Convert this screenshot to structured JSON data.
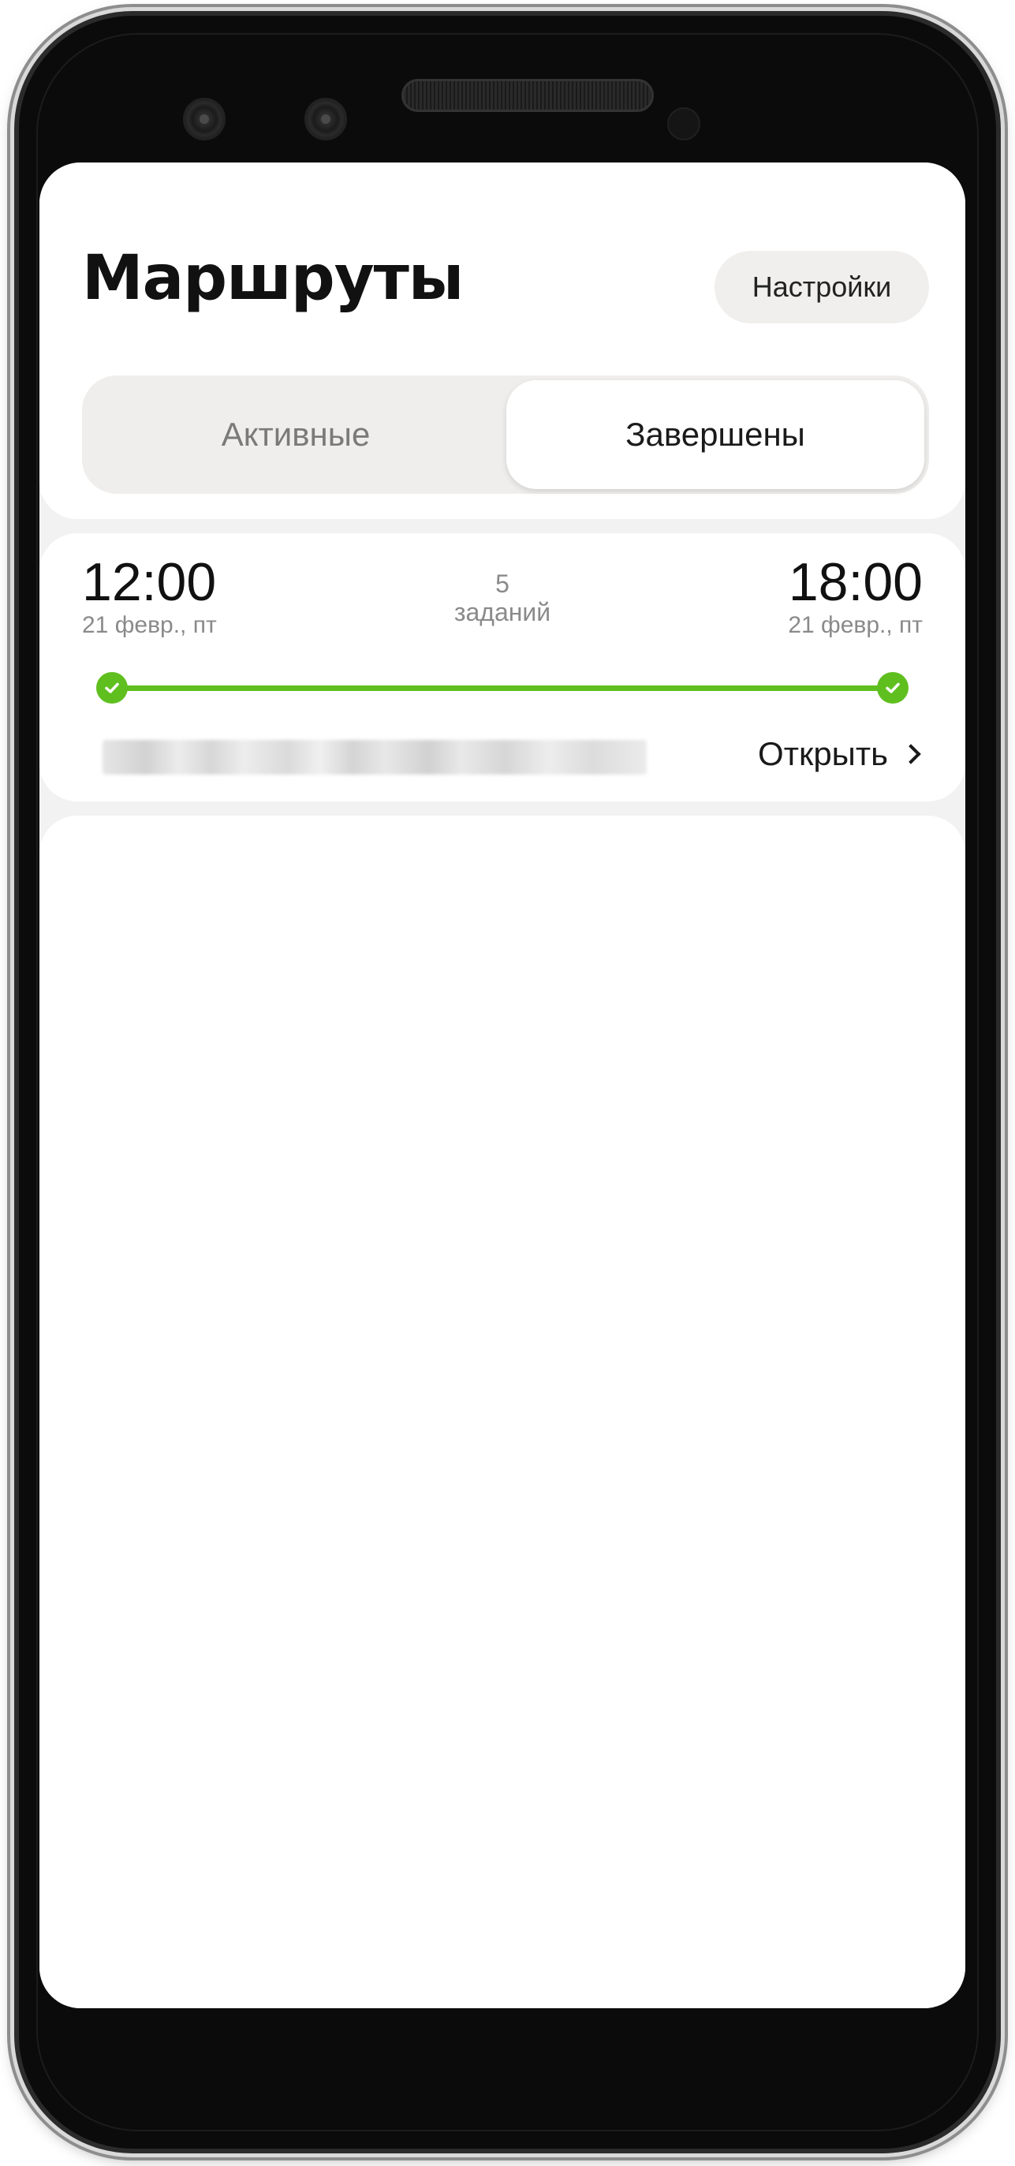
{
  "header": {
    "title": "Маршруты",
    "settings_label": "Настройки"
  },
  "tabs": [
    {
      "label": "Активные",
      "active": false
    },
    {
      "label": "Завершены",
      "active": true
    }
  ],
  "route": {
    "start_time": "12:00",
    "start_date": "21 февр., пт",
    "end_time": "18:00",
    "end_date": "21 февр., пт",
    "tasks_count": "5",
    "tasks_label": "заданий",
    "progress_fraction": 1.0,
    "open_label": "Открыть",
    "status_color": "#5fbf1f"
  },
  "icons": {
    "start_point": "check-circle-icon",
    "end_point": "check-circle-icon",
    "open_chevron": "chevron-right-icon"
  }
}
